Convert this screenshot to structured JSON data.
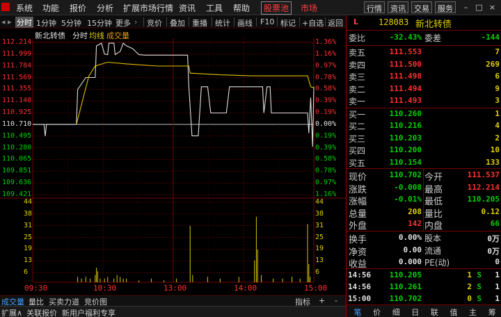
{
  "menubar": {
    "items": [
      "系统",
      "功能",
      "报价",
      "分析",
      "扩展市场行情",
      "资讯",
      "工具",
      "帮助"
    ],
    "highlight": "股票池",
    "market": "市场",
    "tools": [
      "行情",
      "资讯",
      "交易",
      "服务"
    ]
  },
  "toolbar": {
    "items": [
      "分时",
      "1分钟",
      "5分钟",
      "15分钟",
      "更多",
      "竞价",
      "叠加",
      "重播",
      "统计",
      "画线",
      "F10",
      "标记",
      "+自选",
      "返回"
    ]
  },
  "chart": {
    "title": "新北转债",
    "subtitle": "分时",
    "legend_avg": "均线",
    "legend_vol": "成交量",
    "time_labels": [
      "09:30",
      "10:30",
      "13:00",
      "14:00",
      "15:00"
    ],
    "price_labels": [
      "112.214",
      "111.999",
      "111.784",
      "111.569",
      "111.355",
      "111.140",
      "110.925",
      "110.710",
      "110.495",
      "110.280",
      "110.065",
      "109.851",
      "109.636",
      "109.421"
    ],
    "pct_labels": [
      "1.36%",
      "1.16%",
      "0.97%",
      "0.78%",
      "0.58%",
      "0.39%",
      "0.19%",
      "0.00%",
      "0.19%",
      "0.39%",
      "0.58%",
      "0.78%",
      "0.97%",
      "1.16%"
    ],
    "vol_labels": [
      "44",
      "38",
      "31",
      "25",
      "19",
      "13",
      "6"
    ]
  },
  "chart_data": {
    "type": "line",
    "title": "新北转债",
    "x": [
      "09:30",
      "10:30",
      "13:00",
      "14:00",
      "15:00"
    ],
    "ylim": [
      109.421,
      112.214
    ],
    "prev_close": 110.71,
    "series": [
      {
        "name": "price",
        "color": "#e0e0e0",
        "points": [
          [
            0,
            110.71
          ],
          [
            18,
            110.71
          ],
          [
            20,
            110.495
          ],
          [
            22,
            110.71
          ],
          [
            40,
            110.71
          ],
          [
            70,
            110.71
          ],
          [
            72,
            111.35
          ],
          [
            85,
            111.57
          ],
          [
            100,
            111.57
          ],
          [
            102,
            112.15
          ],
          [
            110,
            112.2
          ],
          [
            115,
            112.0
          ],
          [
            120,
            111.99
          ],
          [
            122,
            112.2
          ],
          [
            130,
            112.2
          ],
          [
            132,
            111.99
          ],
          [
            140,
            112.05
          ],
          [
            145,
            112.2
          ],
          [
            150,
            112.15
          ],
          [
            160,
            112.1
          ],
          [
            170,
            111.99
          ],
          [
            180,
            111.98
          ],
          [
            190,
            111.98
          ],
          [
            210,
            111.98
          ],
          [
            230,
            111.98
          ],
          [
            248,
            111.98
          ],
          [
            250,
            111.4
          ],
          [
            255,
            110.5
          ],
          [
            265,
            110.5
          ],
          [
            270,
            111.4
          ],
          [
            280,
            111.4
          ],
          [
            285,
            110.92
          ],
          [
            310,
            110.92
          ],
          [
            315,
            111.4
          ],
          [
            320,
            111.4
          ],
          [
            330,
            111.4
          ],
          [
            360,
            111.4
          ],
          [
            368,
            111.4
          ],
          [
            370,
            110.92
          ],
          [
            375,
            111.4
          ],
          [
            380,
            111.4
          ],
          [
            382,
            110.92
          ],
          [
            395,
            110.92
          ],
          [
            400,
            110.92
          ],
          [
            430,
            110.92
          ],
          [
            440,
            110.92
          ],
          [
            442,
            110.55
          ],
          [
            445,
            111.2
          ],
          [
            448,
            110.3
          ],
          [
            450,
            111.4
          ]
        ]
      },
      {
        "name": "均线",
        "color": "#e0c000",
        "points": [
          [
            70,
            110.71
          ],
          [
            90,
            111.6
          ],
          [
            100,
            111.78
          ],
          [
            120,
            111.85
          ],
          [
            150,
            111.82
          ],
          [
            200,
            111.78
          ],
          [
            250,
            111.78
          ],
          [
            252,
            111.65
          ],
          [
            300,
            111.62
          ],
          [
            350,
            111.6
          ],
          [
            400,
            111.6
          ],
          [
            440,
            111.6
          ],
          [
            445,
            111.4
          ],
          [
            450,
            111.38
          ]
        ]
      }
    ],
    "volume": {
      "name": "成交量",
      "ylim": [
        0,
        44
      ],
      "bars": [
        [
          72,
          3
        ],
        [
          78,
          2
        ],
        [
          85,
          3
        ],
        [
          92,
          2
        ],
        [
          100,
          4
        ],
        [
          102,
          8
        ],
        [
          104,
          6
        ],
        [
          108,
          2
        ],
        [
          115,
          2
        ],
        [
          120,
          3
        ],
        [
          130,
          2
        ],
        [
          135,
          4
        ],
        [
          140,
          3
        ],
        [
          145,
          2
        ],
        [
          150,
          2
        ],
        [
          170,
          1
        ],
        [
          190,
          2
        ],
        [
          210,
          1
        ],
        [
          230,
          2
        ],
        [
          252,
          31
        ],
        [
          256,
          4
        ],
        [
          280,
          3
        ],
        [
          300,
          2
        ],
        [
          330,
          3
        ],
        [
          355,
          12
        ],
        [
          358,
          36
        ],
        [
          360,
          18
        ],
        [
          366,
          4
        ],
        [
          385,
          2
        ],
        [
          400,
          2
        ],
        [
          415,
          3
        ],
        [
          428,
          2
        ],
        [
          440,
          32
        ],
        [
          442,
          10
        ],
        [
          444,
          3
        ]
      ]
    }
  },
  "bottom_tabs": [
    "成交量",
    "量比",
    "买卖力道",
    "竞价图"
  ],
  "bottom_right": [
    "指标",
    "+",
    "-"
  ],
  "status_bar": [
    "扩展∧",
    "关联报价",
    "新用户福利专享"
  ],
  "right_panel": {
    "code_tag": "L",
    "code": "128083",
    "name": "新北转债",
    "weibi": {
      "label": "委比",
      "value": "-32.43%",
      "label2": "委差",
      "value2": "-144"
    },
    "sell": [
      {
        "label": "卖五",
        "price": "111.553",
        "vol": "7"
      },
      {
        "label": "卖四",
        "price": "111.500",
        "vol": "269"
      },
      {
        "label": "卖三",
        "price": "111.498",
        "vol": "6"
      },
      {
        "label": "卖二",
        "price": "111.494",
        "vol": "9"
      },
      {
        "label": "卖一",
        "price": "111.493",
        "vol": "3"
      }
    ],
    "buy": [
      {
        "label": "买一",
        "price": "110.260",
        "vol": "1"
      },
      {
        "label": "买二",
        "price": "110.216",
        "vol": "4"
      },
      {
        "label": "买三",
        "price": "110.203",
        "vol": "2"
      },
      {
        "label": "买四",
        "price": "110.200",
        "vol": "10"
      },
      {
        "label": "买五",
        "price": "110.154",
        "vol": "133"
      }
    ],
    "stats": [
      {
        "l1": "现价",
        "v1": "110.702",
        "c1": "green",
        "l2": "今开",
        "v2": "111.537",
        "c2": "red"
      },
      {
        "l1": "涨跌",
        "v1": "-0.008",
        "c1": "green",
        "l2": "最高",
        "v2": "112.214",
        "c2": "red"
      },
      {
        "l1": "涨幅",
        "v1": "-0.01%",
        "c1": "green",
        "l2": "最低",
        "v2": "110.205",
        "c2": "green"
      },
      {
        "l1": "总量",
        "v1": "208",
        "c1": "yellow",
        "l2": "量比",
        "v2": "0.12",
        "c2": "yellow"
      },
      {
        "l1": "外盘",
        "v1": "142",
        "c1": "red",
        "l2": "内盘",
        "v2": "66",
        "c2": "green"
      }
    ],
    "stats2": [
      {
        "l1": "换手",
        "v1": "0.00%",
        "l2": "股本",
        "v2": "0万"
      },
      {
        "l1": "净资",
        "v1": "0.00",
        "l2": "流通",
        "v2": "0万"
      },
      {
        "l1": "收益",
        "v1": "0.000",
        "l2": "PE(动)",
        "v2": "0"
      }
    ],
    "ticks": [
      {
        "time": "14:56",
        "price": "110.205",
        "vol": "1",
        "side": "S",
        "n": "1"
      },
      {
        "time": "14:56",
        "price": "110.261",
        "vol": "2",
        "side": "S",
        "n": "1"
      },
      {
        "time": "15:00",
        "price": "110.702",
        "vol": "0",
        "side": "S",
        "n": "1"
      }
    ],
    "tabs": [
      "笔",
      "价",
      "细",
      "日",
      "联",
      "值",
      "主",
      "筹"
    ]
  },
  "colors": {
    "up": "#ff3030",
    "down": "#00d000",
    "grid": "#7a0000",
    "bg": "#000000",
    "accent": "#4aa0ff"
  }
}
